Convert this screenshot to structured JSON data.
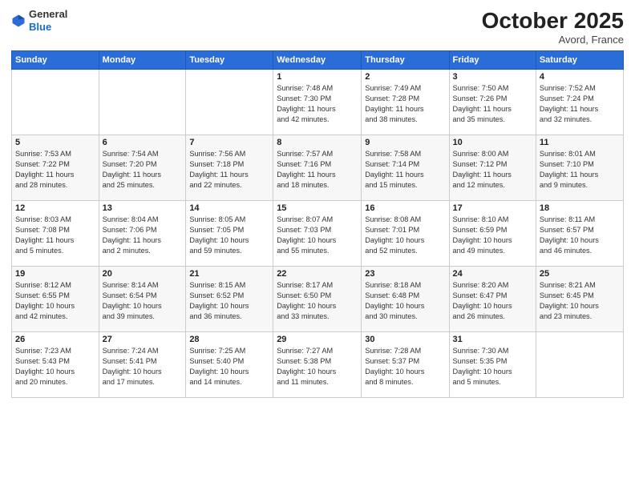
{
  "header": {
    "logo_general": "General",
    "logo_blue": "Blue",
    "month_title": "October 2025",
    "location": "Avord, France"
  },
  "days_of_week": [
    "Sunday",
    "Monday",
    "Tuesday",
    "Wednesday",
    "Thursday",
    "Friday",
    "Saturday"
  ],
  "weeks": [
    [
      {
        "day": "",
        "info": ""
      },
      {
        "day": "",
        "info": ""
      },
      {
        "day": "",
        "info": ""
      },
      {
        "day": "1",
        "info": "Sunrise: 7:48 AM\nSunset: 7:30 PM\nDaylight: 11 hours\nand 42 minutes."
      },
      {
        "day": "2",
        "info": "Sunrise: 7:49 AM\nSunset: 7:28 PM\nDaylight: 11 hours\nand 38 minutes."
      },
      {
        "day": "3",
        "info": "Sunrise: 7:50 AM\nSunset: 7:26 PM\nDaylight: 11 hours\nand 35 minutes."
      },
      {
        "day": "4",
        "info": "Sunrise: 7:52 AM\nSunset: 7:24 PM\nDaylight: 11 hours\nand 32 minutes."
      }
    ],
    [
      {
        "day": "5",
        "info": "Sunrise: 7:53 AM\nSunset: 7:22 PM\nDaylight: 11 hours\nand 28 minutes."
      },
      {
        "day": "6",
        "info": "Sunrise: 7:54 AM\nSunset: 7:20 PM\nDaylight: 11 hours\nand 25 minutes."
      },
      {
        "day": "7",
        "info": "Sunrise: 7:56 AM\nSunset: 7:18 PM\nDaylight: 11 hours\nand 22 minutes."
      },
      {
        "day": "8",
        "info": "Sunrise: 7:57 AM\nSunset: 7:16 PM\nDaylight: 11 hours\nand 18 minutes."
      },
      {
        "day": "9",
        "info": "Sunrise: 7:58 AM\nSunset: 7:14 PM\nDaylight: 11 hours\nand 15 minutes."
      },
      {
        "day": "10",
        "info": "Sunrise: 8:00 AM\nSunset: 7:12 PM\nDaylight: 11 hours\nand 12 minutes."
      },
      {
        "day": "11",
        "info": "Sunrise: 8:01 AM\nSunset: 7:10 PM\nDaylight: 11 hours\nand 9 minutes."
      }
    ],
    [
      {
        "day": "12",
        "info": "Sunrise: 8:03 AM\nSunset: 7:08 PM\nDaylight: 11 hours\nand 5 minutes."
      },
      {
        "day": "13",
        "info": "Sunrise: 8:04 AM\nSunset: 7:06 PM\nDaylight: 11 hours\nand 2 minutes."
      },
      {
        "day": "14",
        "info": "Sunrise: 8:05 AM\nSunset: 7:05 PM\nDaylight: 10 hours\nand 59 minutes."
      },
      {
        "day": "15",
        "info": "Sunrise: 8:07 AM\nSunset: 7:03 PM\nDaylight: 10 hours\nand 55 minutes."
      },
      {
        "day": "16",
        "info": "Sunrise: 8:08 AM\nSunset: 7:01 PM\nDaylight: 10 hours\nand 52 minutes."
      },
      {
        "day": "17",
        "info": "Sunrise: 8:10 AM\nSunset: 6:59 PM\nDaylight: 10 hours\nand 49 minutes."
      },
      {
        "day": "18",
        "info": "Sunrise: 8:11 AM\nSunset: 6:57 PM\nDaylight: 10 hours\nand 46 minutes."
      }
    ],
    [
      {
        "day": "19",
        "info": "Sunrise: 8:12 AM\nSunset: 6:55 PM\nDaylight: 10 hours\nand 42 minutes."
      },
      {
        "day": "20",
        "info": "Sunrise: 8:14 AM\nSunset: 6:54 PM\nDaylight: 10 hours\nand 39 minutes."
      },
      {
        "day": "21",
        "info": "Sunrise: 8:15 AM\nSunset: 6:52 PM\nDaylight: 10 hours\nand 36 minutes."
      },
      {
        "day": "22",
        "info": "Sunrise: 8:17 AM\nSunset: 6:50 PM\nDaylight: 10 hours\nand 33 minutes."
      },
      {
        "day": "23",
        "info": "Sunrise: 8:18 AM\nSunset: 6:48 PM\nDaylight: 10 hours\nand 30 minutes."
      },
      {
        "day": "24",
        "info": "Sunrise: 8:20 AM\nSunset: 6:47 PM\nDaylight: 10 hours\nand 26 minutes."
      },
      {
        "day": "25",
        "info": "Sunrise: 8:21 AM\nSunset: 6:45 PM\nDaylight: 10 hours\nand 23 minutes."
      }
    ],
    [
      {
        "day": "26",
        "info": "Sunrise: 7:23 AM\nSunset: 5:43 PM\nDaylight: 10 hours\nand 20 minutes."
      },
      {
        "day": "27",
        "info": "Sunrise: 7:24 AM\nSunset: 5:41 PM\nDaylight: 10 hours\nand 17 minutes."
      },
      {
        "day": "28",
        "info": "Sunrise: 7:25 AM\nSunset: 5:40 PM\nDaylight: 10 hours\nand 14 minutes."
      },
      {
        "day": "29",
        "info": "Sunrise: 7:27 AM\nSunset: 5:38 PM\nDaylight: 10 hours\nand 11 minutes."
      },
      {
        "day": "30",
        "info": "Sunrise: 7:28 AM\nSunset: 5:37 PM\nDaylight: 10 hours\nand 8 minutes."
      },
      {
        "day": "31",
        "info": "Sunrise: 7:30 AM\nSunset: 5:35 PM\nDaylight: 10 hours\nand 5 minutes."
      },
      {
        "day": "",
        "info": ""
      }
    ]
  ]
}
